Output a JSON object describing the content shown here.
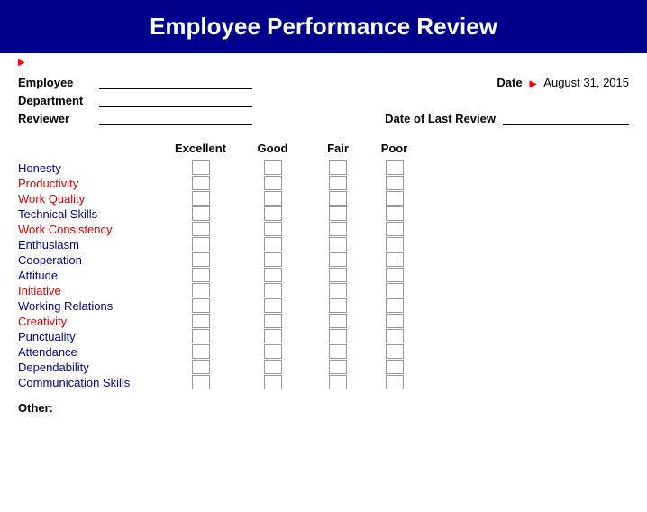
{
  "header": {
    "title": "Employee Performance Review"
  },
  "form": {
    "employee_label": "Employee",
    "department_label": "Department",
    "reviewer_label": "Reviewer",
    "date_label": "Date",
    "date_value": "August 31, 2015",
    "last_review_label": "Date of Last Review"
  },
  "ratings": {
    "columns": [
      "Excellent",
      "Good",
      "Fair",
      "Poor"
    ],
    "skills": [
      {
        "name": "Honesty",
        "color": "blue"
      },
      {
        "name": "Productivity",
        "color": "red"
      },
      {
        "name": "Work Quality",
        "color": "red"
      },
      {
        "name": "Technical Skills",
        "color": "blue"
      },
      {
        "name": "Work Consistency",
        "color": "red"
      },
      {
        "name": "Enthusiasm",
        "color": "blue"
      },
      {
        "name": "Cooperation",
        "color": "blue"
      },
      {
        "name": "Attitude",
        "color": "blue"
      },
      {
        "name": "Initiative",
        "color": "red"
      },
      {
        "name": "Working Relations",
        "color": "blue"
      },
      {
        "name": "Creativity",
        "color": "red"
      },
      {
        "name": "Punctuality",
        "color": "blue"
      },
      {
        "name": "Attendance",
        "color": "blue"
      },
      {
        "name": "Dependability",
        "color": "blue"
      },
      {
        "name": "Communication Skills",
        "color": "blue"
      }
    ]
  },
  "other_label": "Other:"
}
